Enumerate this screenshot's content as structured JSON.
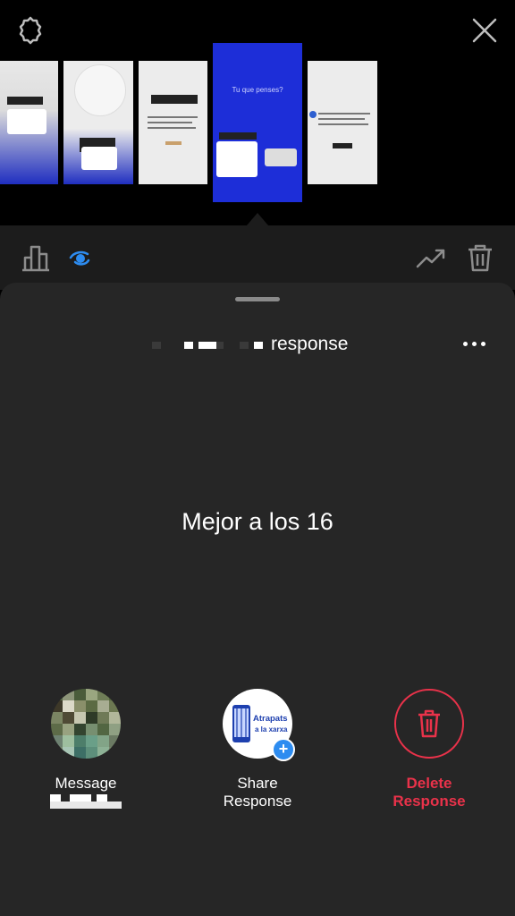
{
  "top_bar": {
    "settings_icon": "gear-outline-icon",
    "close_icon": "close-x-icon"
  },
  "story_strip": {
    "thumbnails": [
      {
        "name": "story-1",
        "active": false
      },
      {
        "name": "story-2",
        "active": false
      },
      {
        "name": "story-3",
        "active": false
      },
      {
        "name": "story-4",
        "active": true,
        "caption": "Tu que penses?"
      },
      {
        "name": "story-5",
        "active": false
      }
    ],
    "active_color": "#1d2ed8"
  },
  "action_row": {
    "insights_icon": "bar-chart-icon",
    "viewers_icon": "eye-icon",
    "promote_icon": "trending-up-icon",
    "delete_icon": "trash-icon",
    "viewers_color": "#2d8cf0"
  },
  "sheet": {
    "header_title": "response",
    "more_icon": "more-horizontal-icon",
    "response_text": "Mejor a los 16",
    "actions": {
      "message_label": "Message",
      "share_label_1": "Share",
      "share_label_2": "Response",
      "share_logo_text_1": "Atrapats",
      "share_logo_text_2": "a la xarxa",
      "delete_label_1": "Delete",
      "delete_label_2": "Response",
      "delete_color": "#e9324a"
    }
  }
}
